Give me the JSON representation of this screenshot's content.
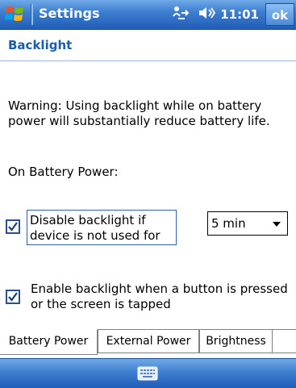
{
  "titlebar": {
    "title": "Settings",
    "clock": "11:01",
    "ok_label": "ok",
    "icons": [
      "windows-start-icon",
      "connectivity-icon",
      "volume-icon"
    ]
  },
  "page": {
    "heading": "Backlight"
  },
  "content": {
    "warning": "Warning: Using backlight while on battery power will substantially reduce battery life.",
    "section_label": "On Battery Power:",
    "option1": {
      "line1": "Disable backlight if",
      "line2": "device is not used for",
      "checked": true
    },
    "timeout": {
      "value": "5 min"
    },
    "option2": {
      "label": "Enable backlight when a button is pressed or the screen is tapped",
      "checked": true
    }
  },
  "tabs": [
    {
      "label": "Battery Power",
      "active": true
    },
    {
      "label": "External Power",
      "active": false
    },
    {
      "label": "Brightness",
      "active": false
    }
  ],
  "menubar": {
    "icons": [
      "keyboard-icon"
    ]
  },
  "colors": {
    "titlebar_blue": "#3f7fd0",
    "heading_blue": "#1a5dab",
    "focus_border": "#2c5fb0"
  }
}
